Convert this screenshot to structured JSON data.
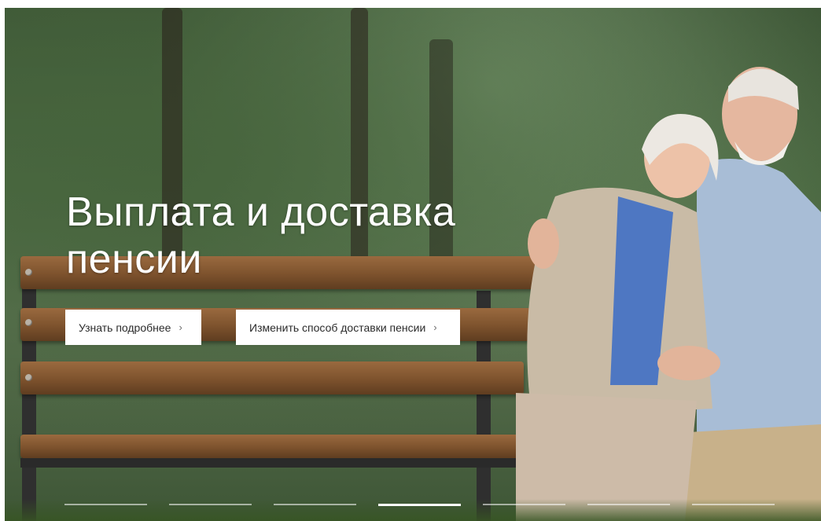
{
  "hero": {
    "headline_line1": "Выплата и доставка",
    "headline_line2": "пенсии",
    "buttons": [
      {
        "label": "Узнать подробнее",
        "icon": "chevron-right-icon"
      },
      {
        "label": "Изменить способ доставки пенсии",
        "icon": "chevron-right-icon"
      }
    ],
    "carousel": {
      "slide_count": 7,
      "active_index": 3
    },
    "colors": {
      "headline": "#ffffff",
      "button_bg": "#ffffff",
      "button_text": "#2b2b2b"
    }
  }
}
